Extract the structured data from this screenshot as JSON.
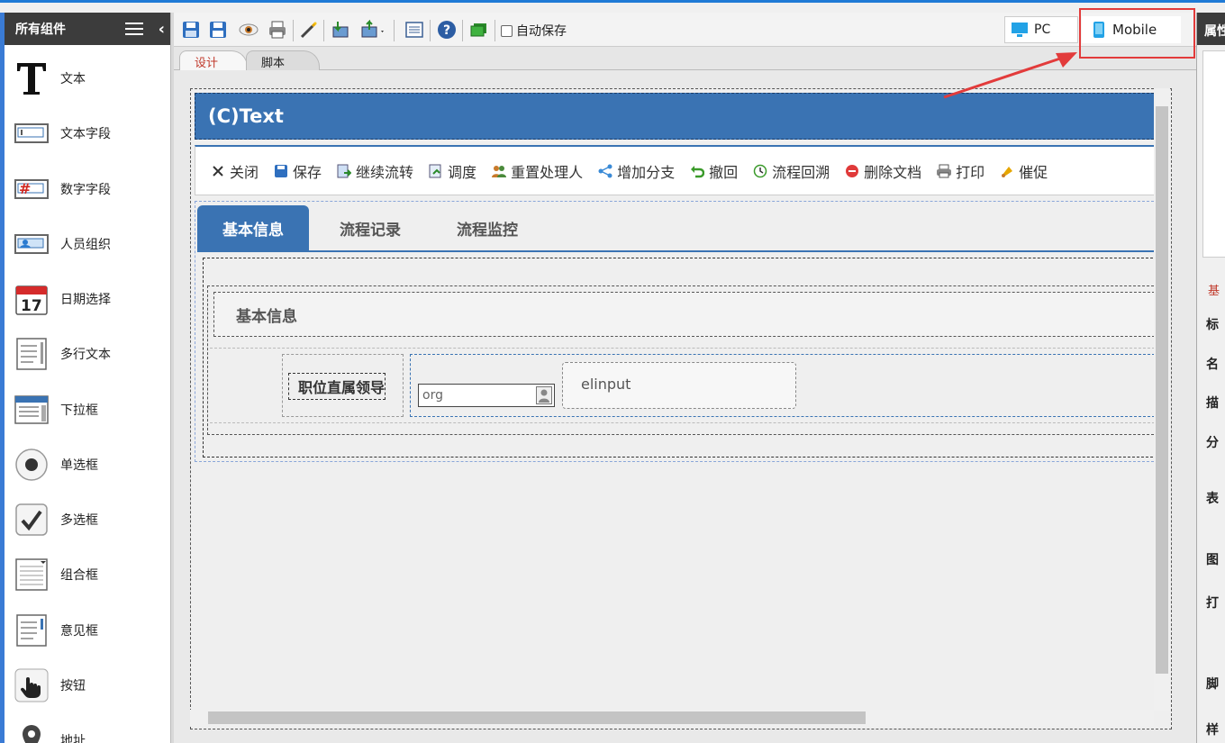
{
  "palette": {
    "title": "所有组件",
    "items": [
      {
        "label": "文本",
        "icon": "text-t-icon"
      },
      {
        "label": "文本字段",
        "icon": "text-field-icon"
      },
      {
        "label": "数字字段",
        "icon": "number-field-icon"
      },
      {
        "label": "人员组织",
        "icon": "person-org-icon"
      },
      {
        "label": "日期选择",
        "icon": "calendar-icon"
      },
      {
        "label": "多行文本",
        "icon": "multiline-text-icon"
      },
      {
        "label": "下拉框",
        "icon": "dropdown-icon"
      },
      {
        "label": "单选框",
        "icon": "radio-icon"
      },
      {
        "label": "多选框",
        "icon": "checkbox-icon"
      },
      {
        "label": "组合框",
        "icon": "combobox-icon"
      },
      {
        "label": "意见框",
        "icon": "opinion-box-icon"
      },
      {
        "label": "按钮",
        "icon": "hand-pointer-icon"
      },
      {
        "label": "地址",
        "icon": "map-pin-icon"
      }
    ],
    "calendar_number": "17"
  },
  "toolbar": {
    "autosave_label": "自动保存",
    "device_pc": "PC",
    "device_mobile": "Mobile"
  },
  "editor_tabs": {
    "design": "设计",
    "script": "脚本"
  },
  "form": {
    "title": "(C)Text",
    "actions": [
      "关闭",
      "保存",
      "继续流转",
      "调度",
      "重置处理人",
      "增加分支",
      "撤回",
      "流程回溯",
      "删除文档",
      "打印",
      "催促"
    ],
    "tabs": [
      "基本信息",
      "流程记录",
      "流程监控"
    ],
    "section_title": "基本信息",
    "field_label": "职位直属领导",
    "org_value": "org",
    "elinput_text": "elinput"
  },
  "props": {
    "title": "属性",
    "rows": [
      "标",
      "名",
      "描",
      "分",
      "表",
      "图",
      "打",
      "脚",
      "样"
    ],
    "tab_label": "基"
  },
  "colors": {
    "accent": "#3a73b3",
    "highlight": "#e23b3b"
  }
}
